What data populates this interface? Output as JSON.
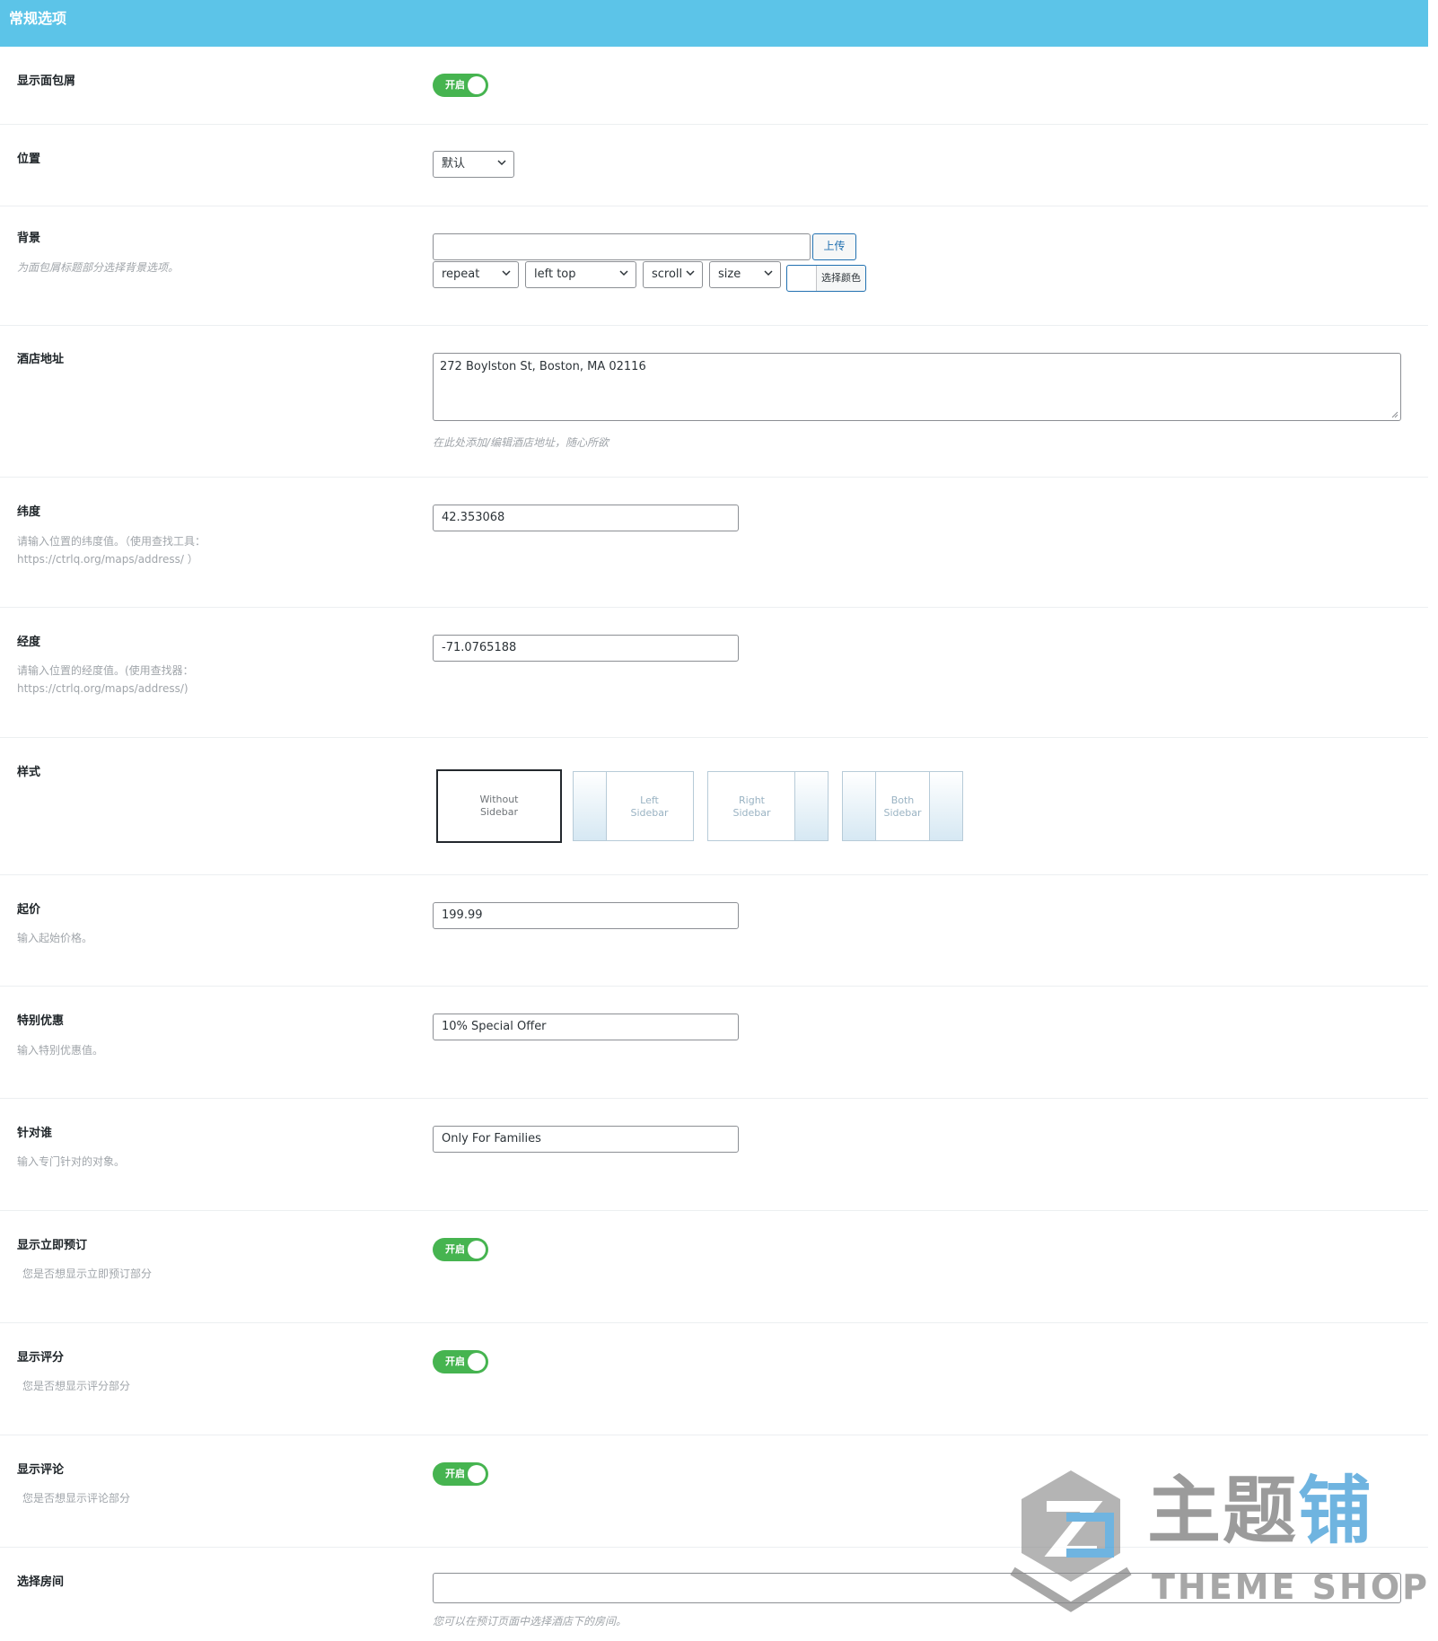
{
  "header": {
    "title": "常规选项"
  },
  "rows": {
    "breadcrumb": {
      "label": "显示面包屑",
      "toggle": "开启"
    },
    "position": {
      "label": "位置",
      "select": "默认"
    },
    "background": {
      "label": "背景",
      "desc": "为面包屑标题部分选择背景选项。",
      "upload_value": "",
      "upload_button": "上传",
      "repeat": "repeat",
      "position": "left top",
      "attachment": "scroll",
      "size": "size",
      "color_button": "选择颜色"
    },
    "address": {
      "label": "酒店地址",
      "value": "272 Boylston St, Boston, MA 02116",
      "desc": "在此处添加/编辑酒店地址，随心所欲"
    },
    "latitude": {
      "label": "纬度",
      "desc1": "请输入位置的纬度值。（使用查找工具：",
      "desc2": "https://ctrlq.org/maps/address/ ）",
      "value": "42.353068"
    },
    "longitude": {
      "label": "经度",
      "desc1": "请输入位置的经度值。(使用查找器：",
      "desc2": "https://ctrlq.org/maps/address/)",
      "value": "-71.0765188"
    },
    "style": {
      "label": "样式",
      "options": [
        {
          "line1": "Without",
          "line2": "Sidebar"
        },
        {
          "line1": "Left",
          "line2": "Sidebar"
        },
        {
          "line1": "Right",
          "line2": "Sidebar"
        },
        {
          "line1": "Both",
          "line2": "Sidebar"
        }
      ],
      "selected": "Without Sidebar"
    },
    "price": {
      "label": "起价",
      "desc": "输入起始价格。",
      "value": "199.99"
    },
    "offer": {
      "label": "特别优惠",
      "desc": "输入特别优惠值。",
      "value": "10% Special Offer"
    },
    "target": {
      "label": "针对谁",
      "desc": "输入专门针对的对象。",
      "value": "Only For Families"
    },
    "book_now": {
      "label": "显示立即预订",
      "desc": "您是否想显示立即预订部分",
      "toggle": "开启"
    },
    "rating": {
      "label": "显示评分",
      "desc": "您是否想显示评分部分",
      "toggle": "开启"
    },
    "comments": {
      "label": "显示评论",
      "desc": "您是否想显示评论部分",
      "toggle": "开启"
    },
    "rooms": {
      "label": "选择房间",
      "value": "",
      "desc": "您可以在预订页面中选择酒店下的房间。"
    }
  },
  "watermark": {
    "cn_gray": "主题",
    "cn_blue": "铺",
    "en": "THEME SHOP"
  },
  "colors": {
    "header": "#5cc4e8",
    "toggle_on": "#46b450",
    "button_border": "#2271b1"
  }
}
